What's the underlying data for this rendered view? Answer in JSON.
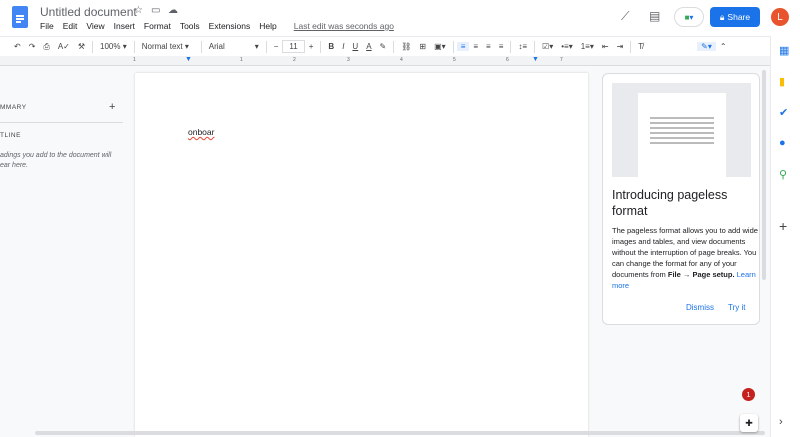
{
  "header": {
    "title": "Untitled document",
    "menu": [
      "File",
      "Edit",
      "View",
      "Insert",
      "Format",
      "Tools",
      "Extensions",
      "Help"
    ],
    "last_edit": "Last edit was seconds ago",
    "share_label": "Share",
    "avatar_letter": "L"
  },
  "toolbar": {
    "zoom": "100%",
    "style": "Normal text",
    "font": "Arial",
    "font_size": "11"
  },
  "ruler": {
    "labels": [
      "1",
      "1",
      "2",
      "3",
      "4",
      "5",
      "6",
      "7"
    ]
  },
  "outline": {
    "summary_label": "MMARY",
    "outline_label": "TLINE",
    "hint": "adings you add to the document will\near here."
  },
  "document": {
    "text": "onboar"
  },
  "card": {
    "title": "Introducing pageless format",
    "body": "The pageless format allows you to add wide images and tables, and view documents without the interruption of page breaks. You can change the format for any of your documents from ",
    "bold": "File → Page setup.",
    "learn_more": "Learn more",
    "dismiss": "Dismiss",
    "try_it": "Try it"
  },
  "notification_count": "1",
  "colors": {
    "accent": "#1a73e8",
    "avatar": "#e8542e",
    "badge": "#c5221f"
  }
}
